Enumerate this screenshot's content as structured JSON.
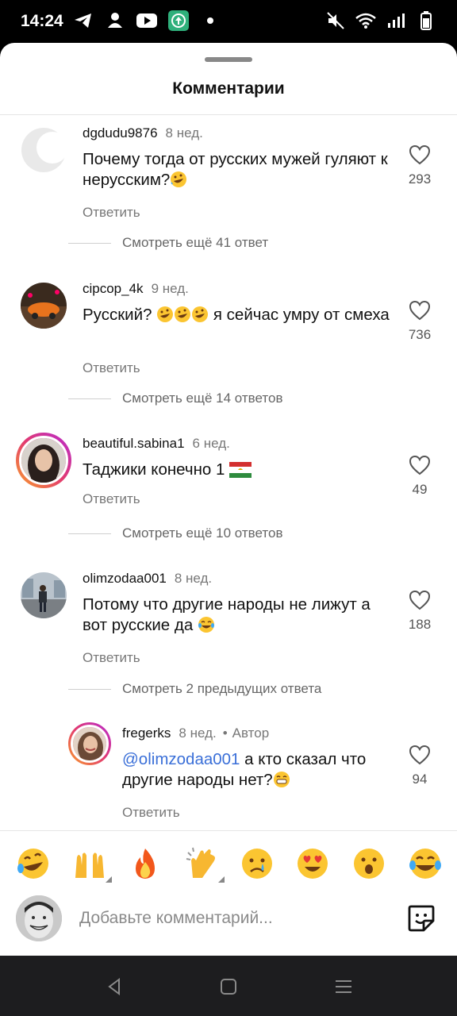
{
  "status_bar": {
    "time": "14:24",
    "left_icons": [
      "telegram-icon",
      "person-icon",
      "youtube-icon",
      "upload-app-icon",
      "dot-icon"
    ],
    "right_icons": [
      "mute-icon",
      "wifi-icon",
      "signal-icon",
      "battery-icon"
    ]
  },
  "sheet": {
    "title": "Комментарии"
  },
  "comments": [
    {
      "username": "dgdudu9876",
      "time": "8 нед.",
      "text": "Почему тогда от русских мужей гуляют к нерусским?",
      "text_emoji": "rofl",
      "reply_label": "Ответить",
      "likes": "293",
      "more_replies": "Смотреть ещё 41 ответ"
    },
    {
      "username": "cipcop_4k",
      "time": "9 нед.",
      "text_before": "Русский?",
      "text_emojis": [
        "rofl",
        "rofl",
        "rofl"
      ],
      "text_after": " я сейчас умру от смеха",
      "reply_label": "Ответить",
      "likes": "736",
      "more_replies": "Смотреть ещё 14 ответов"
    },
    {
      "username": "beautiful.sabina1",
      "time": "6 нед.",
      "text": "Таджики конечно 1",
      "text_emoji": "flag-tajikistan",
      "reply_label": "Ответить",
      "likes": "49",
      "more_replies": "Смотреть ещё 10 ответов"
    },
    {
      "username": "olimzodaa001",
      "time": "8 нед.",
      "text": "Потому что другие народы не лижут а вот русские да",
      "text_emoji": "joy",
      "reply_label": "Ответить",
      "likes": "188",
      "more_replies": "Смотреть 2 предыдущих ответа"
    }
  ],
  "reply": {
    "username": "fregerks",
    "time": "8 нед.",
    "author_badge": "Автор",
    "mention": "@olimzodaa001",
    "text": " а кто сказал что другие народы нет?",
    "text_emoji": "grin",
    "reply_label": "Ответить",
    "likes": "94"
  },
  "emoji_bar": [
    "rofl",
    "raised-hands",
    "fire",
    "clap",
    "cry",
    "heart-eyes",
    "open-mouth",
    "joy"
  ],
  "input": {
    "placeholder": "Добавьте комментарий..."
  },
  "nav": [
    "back-icon",
    "home-icon",
    "recents-icon"
  ],
  "colors": {
    "accent_mention": "#3a6fd8",
    "secondary_text": "#777777"
  }
}
